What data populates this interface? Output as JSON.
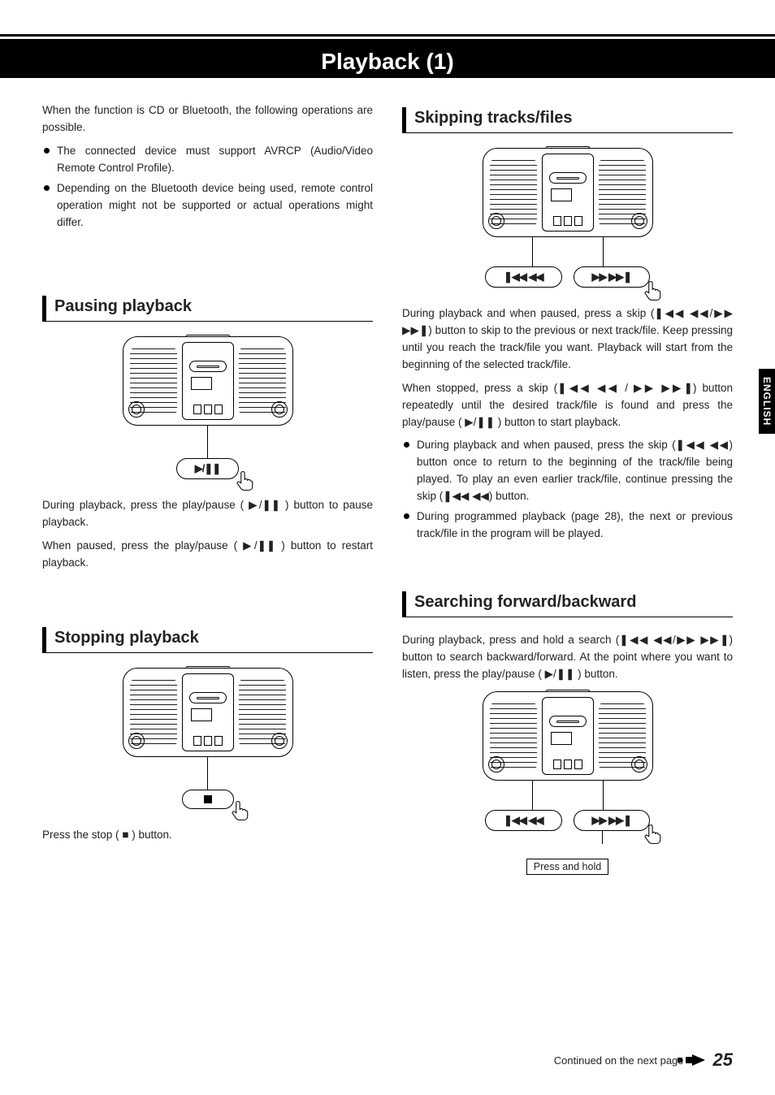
{
  "title": "Playback (1)",
  "side_tab": "ENGLISH",
  "intro": "When the function is CD or Bluetooth, the following operations are possible.",
  "intro_bullets": [
    "The connected device must support AVRCP (Audio/Video Remote Control Profile).",
    "Depending on the Bluetooth device being used, remote control operation might not be supported or actual operations might differ."
  ],
  "pausing": {
    "heading": "Pausing playback",
    "callout_symbol": "▶/❚❚",
    "p1": "During playback, press the play/pause ( ▶/❚❚ ) button to pause playback.",
    "p2": "When paused, press the play/pause ( ▶/❚❚ ) button to restart playback."
  },
  "stopping": {
    "heading": "Stopping playback",
    "callout_symbol": "■",
    "p1": "Press the stop ( ■ ) button."
  },
  "skipping": {
    "heading": "Skipping tracks/files",
    "callout_prev": "❚◀◀ ◀◀",
    "callout_next": "▶▶ ▶▶❚",
    "p1": "During playback and when paused, press a skip (❚◀◀ ◀◀/▶▶ ▶▶❚) button to skip to the previous or next track/file. Keep pressing until you reach the track/file you want. Playback will start from the beginning of the selected track/file.",
    "p2": "When stopped, press a skip (❚◀◀ ◀◀ / ▶▶ ▶▶❚) button repeatedly until the desired track/file is found and press the play/pause ( ▶/❚❚ ) button to start playback.",
    "bullets": [
      "During playback and when paused, press the skip (❚◀◀ ◀◀) button once to return to the beginning of the track/file being played. To play an even earlier track/file, continue pressing the skip (❚◀◀ ◀◀) button.",
      "During programmed playback (page 28), the next or previous track/file in the program will be played."
    ]
  },
  "searching": {
    "heading": "Searching forward/backward",
    "p1": "During playback, press and hold a search (❚◀◀ ◀◀/▶▶ ▶▶❚) button to search backward/forward. At the point where you want to listen, press the play/pause ( ▶/❚❚ ) button.",
    "callout_prev": "❚◀◀ ◀◀",
    "callout_next": "▶▶ ▶▶❚",
    "press_hold": "Press and hold"
  },
  "footer": {
    "continued": "Continued on the next page",
    "page": "25"
  }
}
